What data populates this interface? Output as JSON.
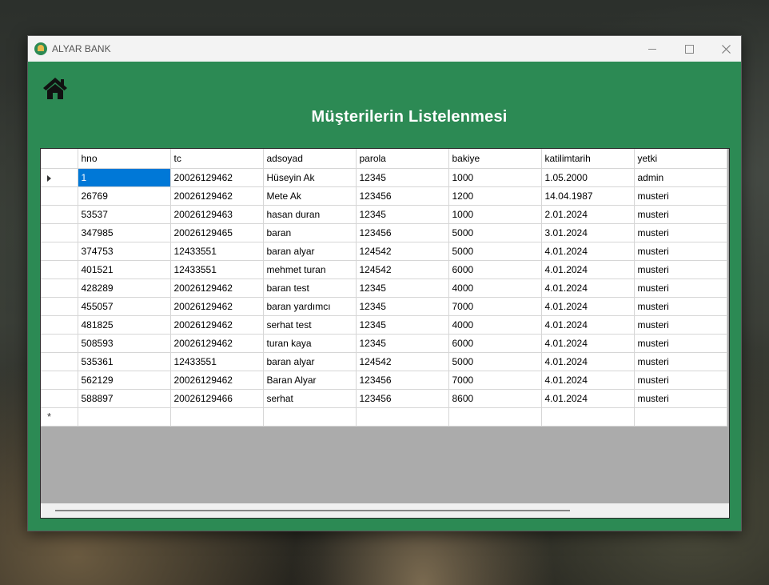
{
  "window": {
    "title": "ALYAR BANK"
  },
  "header": {
    "title": "Müşterilerin Listelenmesi"
  },
  "grid": {
    "columns": [
      "hno",
      "tc",
      "adsoyad",
      "parola",
      "bakiye",
      "katilimtarih",
      "yetki"
    ],
    "rows": [
      [
        "1",
        "20026129462",
        "Hüseyin Ak",
        "12345",
        "1000",
        "1.05.2000",
        "admin"
      ],
      [
        "26769",
        "20026129462",
        "Mete Ak",
        "123456",
        "1200",
        "14.04.1987",
        "musteri"
      ],
      [
        "53537",
        "20026129463",
        "hasan duran",
        "12345",
        "1000",
        "2.01.2024",
        "musteri"
      ],
      [
        "347985",
        "20026129465",
        "baran",
        "123456",
        "5000",
        "3.01.2024",
        "musteri"
      ],
      [
        "374753",
        "12433551",
        "baran alyar",
        "124542",
        "5000",
        "4.01.2024",
        "musteri"
      ],
      [
        "401521",
        "12433551",
        "mehmet turan",
        "124542",
        "6000",
        "4.01.2024",
        "musteri"
      ],
      [
        "428289",
        "20026129462",
        "baran test",
        "12345",
        "4000",
        "4.01.2024",
        "musteri"
      ],
      [
        "455057",
        "20026129462",
        "baran yardımcı",
        "12345",
        "7000",
        "4.01.2024",
        "musteri"
      ],
      [
        "481825",
        "20026129462",
        "serhat test",
        "12345",
        "4000",
        "4.01.2024",
        "musteri"
      ],
      [
        "508593",
        "20026129462",
        "turan kaya",
        "12345",
        "6000",
        "4.01.2024",
        "musteri"
      ],
      [
        "535361",
        "12433551",
        "baran alyar",
        "124542",
        "5000",
        "4.01.2024",
        "musteri"
      ],
      [
        "562129",
        "20026129462",
        "Baran Alyar",
        "123456",
        "7000",
        "4.01.2024",
        "musteri"
      ],
      [
        "588897",
        "20026129466",
        "serhat",
        "123456",
        "8600",
        "4.01.2024",
        "musteri"
      ]
    ],
    "new_row_marker": "*"
  },
  "icons": {
    "app": "bank-logo-icon",
    "home": "home-icon",
    "row_pointer": "current-row-arrow-icon",
    "minimize": "minimize-icon",
    "maximize": "maximize-icon",
    "close": "close-icon"
  },
  "colors": {
    "form_background": "#2c8a54",
    "selection": "#0078d7",
    "grid_background": "#ababab"
  }
}
